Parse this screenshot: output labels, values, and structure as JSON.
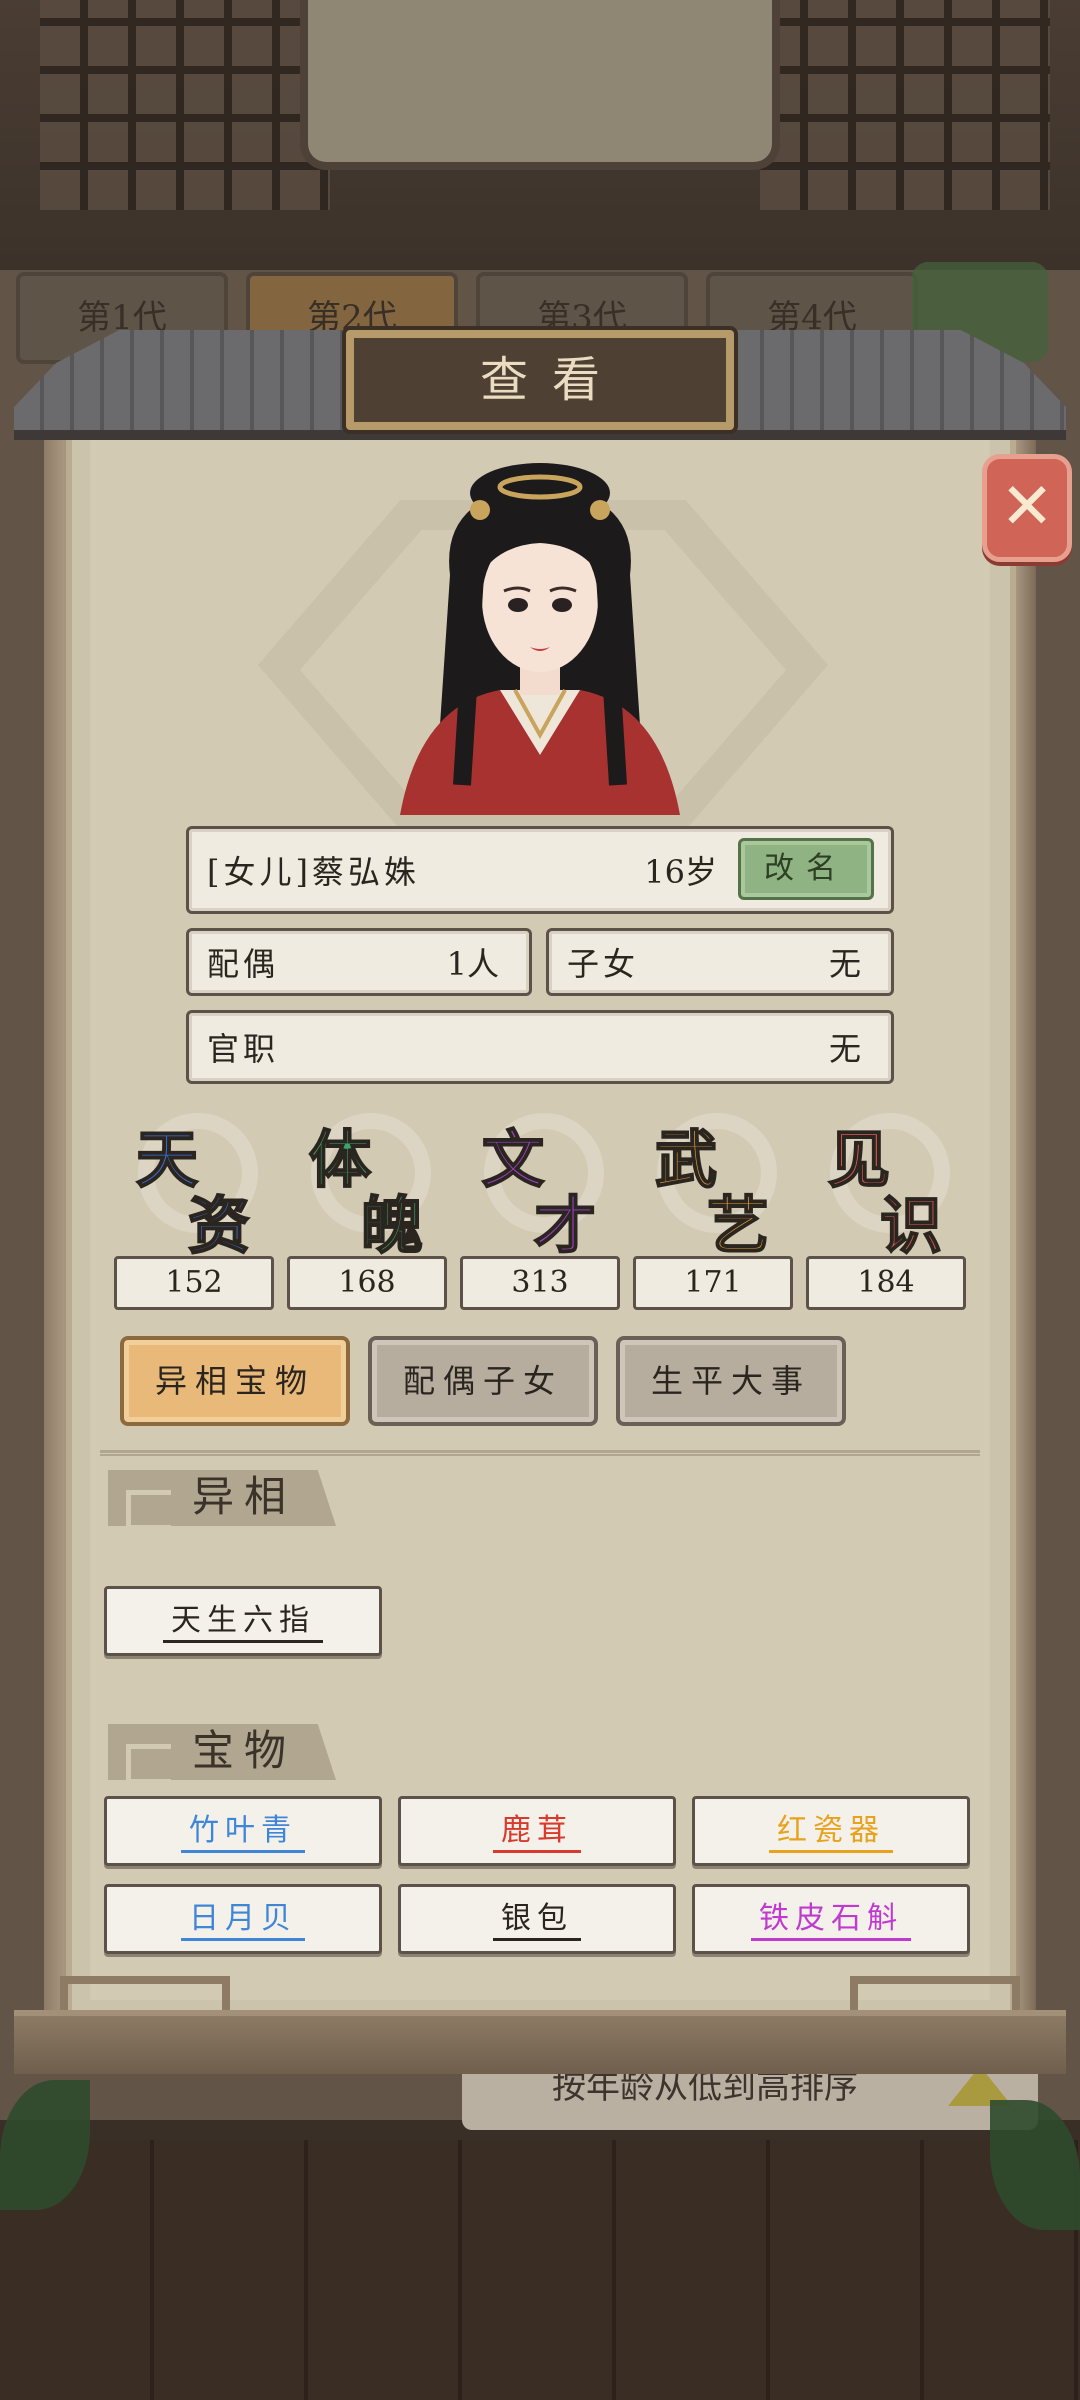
{
  "background": {
    "generation_tabs": [
      {
        "label": "第1代",
        "active": false
      },
      {
        "label": "第2代",
        "active": true
      },
      {
        "label": "第3代",
        "active": false
      },
      {
        "label": "第4代",
        "active": false
      }
    ],
    "sort_label": "按年龄从低到高排序"
  },
  "dialog": {
    "title": "查看",
    "close_icon": "✕"
  },
  "character": {
    "name": "[女儿]蔡弘姝",
    "age": "16岁",
    "rename_label": "改名",
    "spouse_label": "配偶",
    "spouse_value": "1人",
    "children_label": "子女",
    "children_value": "无",
    "official_label": "官职",
    "official_value": "无"
  },
  "stats": [
    {
      "c1": "天",
      "c2": "资",
      "value": "152",
      "color": "#3b6fd8"
    },
    {
      "c1": "体",
      "c2": "魄",
      "value": "168",
      "color": "#3aa46a"
    },
    {
      "c1": "文",
      "c2": "才",
      "value": "313",
      "color": "#a33fcf"
    },
    {
      "c1": "武",
      "c2": "艺",
      "value": "171",
      "color": "#e3a037"
    },
    {
      "c1": "见",
      "c2": "识",
      "value": "184",
      "color": "#dd5b52"
    }
  ],
  "tabs": [
    {
      "label": "异相宝物",
      "active": true
    },
    {
      "label": "配偶子女",
      "active": false
    },
    {
      "label": "生平大事",
      "active": false
    }
  ],
  "traits": {
    "heading": "异相",
    "items": [
      {
        "label": "天生六指",
        "color": "#2b2520"
      }
    ]
  },
  "treasures": {
    "heading": "宝物",
    "items": [
      {
        "label": "竹叶青",
        "color": "#3f86d8"
      },
      {
        "label": "鹿茸",
        "color": "#d83a2e"
      },
      {
        "label": "红瓷器",
        "color": "#e8a21e"
      },
      {
        "label": "日月贝",
        "color": "#3f86d8"
      },
      {
        "label": "银包",
        "color": "#2b2520"
      },
      {
        "label": "铁皮石斛",
        "color": "#c13ad0"
      }
    ]
  }
}
